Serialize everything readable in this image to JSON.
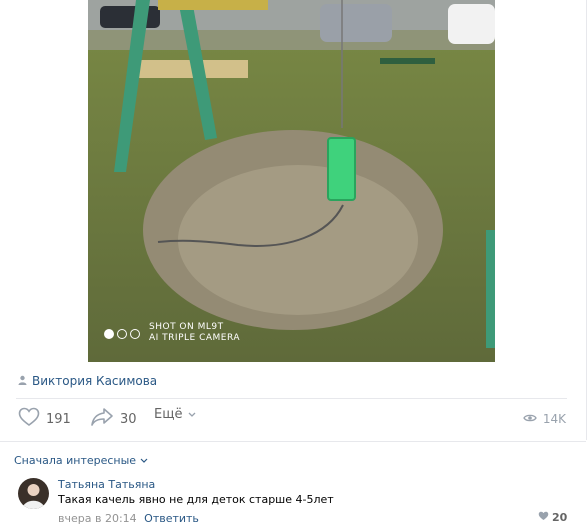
{
  "post": {
    "watermark_line1": "SHOT ON ML9T",
    "watermark_line2": "AI TRIPLE CAMERA",
    "author": "Виктория Касимова",
    "likes": "191",
    "shares": "30",
    "more_label": "Ещё",
    "views": "14K"
  },
  "comments": {
    "sort_label": "Сначала интересные",
    "items": [
      {
        "name": "Татьяна Татьяна",
        "text": "Такая качель явно не для деток старше 4-5лет",
        "time": "вчера в 20:14",
        "reply_label": "Ответить",
        "likes": "20"
      }
    ]
  },
  "colors": {
    "link": "#2a5885",
    "muted": "#99a2ad",
    "border": "#e7e8ec"
  },
  "icons": [
    "person-icon",
    "heart-icon",
    "share-icon",
    "chevron-down-icon",
    "eye-icon"
  ]
}
